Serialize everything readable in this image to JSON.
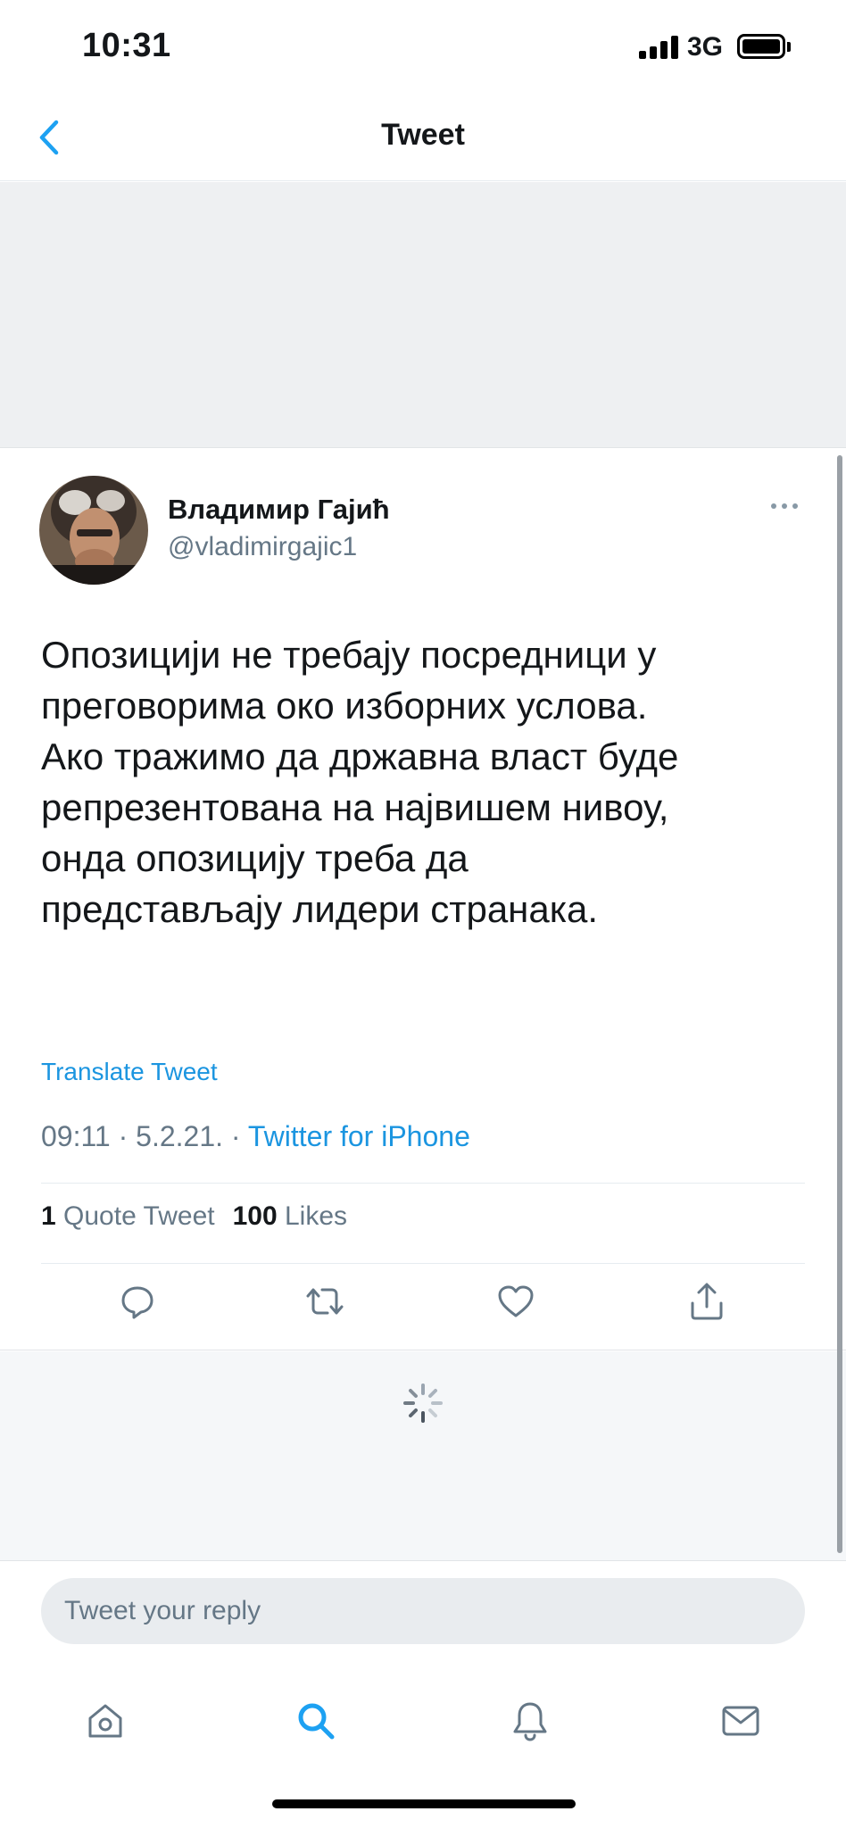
{
  "status_bar": {
    "time": "10:31",
    "network": "3G"
  },
  "header": {
    "title": "Tweet"
  },
  "tweet": {
    "display_name": "Владимир Гајић",
    "username": "@vladimirgajic1",
    "text": "Опозицији не требају посредници у\nпреговорима око изборних услова.\nАко тражимо да државна власт буде\nрепрезентована на највишем нивоу,\nонда опозицију треба да\nпредстављају лидери странака.",
    "translate_label": "Translate Tweet",
    "time": "09:11",
    "date": "5.2.21.",
    "source": "Twitter for iPhone",
    "quote_count": "1",
    "quote_label": "Quote Tweet",
    "like_count": "100",
    "like_label": "Likes"
  },
  "reply": {
    "placeholder": "Tweet your reply"
  },
  "icons": {
    "back": "chevron-left-icon",
    "more": "more-horizontal-icon",
    "reply": "reply-icon",
    "retweet": "retweet-icon",
    "like": "heart-icon",
    "share": "share-icon",
    "loading": "spinner-icon",
    "tabs": [
      "home-icon",
      "search-icon",
      "bell-icon",
      "mail-icon"
    ]
  },
  "colors": {
    "accent": "#1da1f2",
    "text": "#14171a",
    "secondary": "#657786",
    "background_gray": "#eef0f2"
  }
}
